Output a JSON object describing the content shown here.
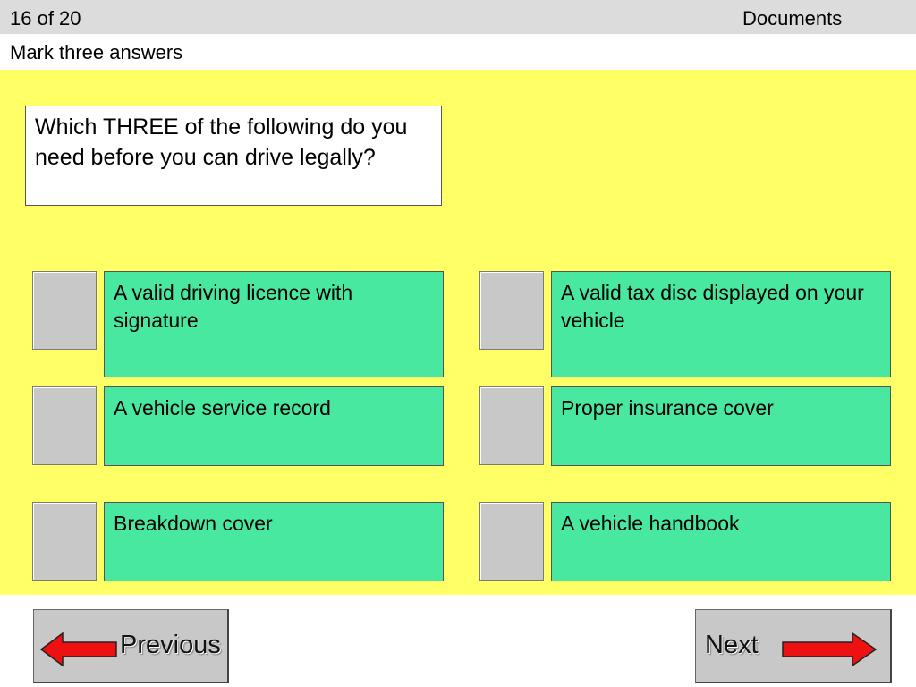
{
  "header": {
    "counter": "16 of 20",
    "category": "Documents"
  },
  "instruction": "Mark three answers",
  "question": "Which THREE of the following do you need before you can drive legally?",
  "answers": [
    "A valid driving licence with signature",
    "A valid tax disc displayed on your vehicle",
    "A vehicle service record",
    "Proper insurance cover",
    "Breakdown cover",
    "A vehicle handbook"
  ],
  "nav": {
    "previous_label": "Previous",
    "next_label": "Next",
    "previous_icon": "left-arrow-icon",
    "next_icon": "right-arrow-icon"
  },
  "colors": {
    "background": "#ffff66",
    "answer": "#48e8a0",
    "checkbox": "#c8c8c8",
    "arrow": "#ee1111",
    "header": "#dcdcdc"
  }
}
